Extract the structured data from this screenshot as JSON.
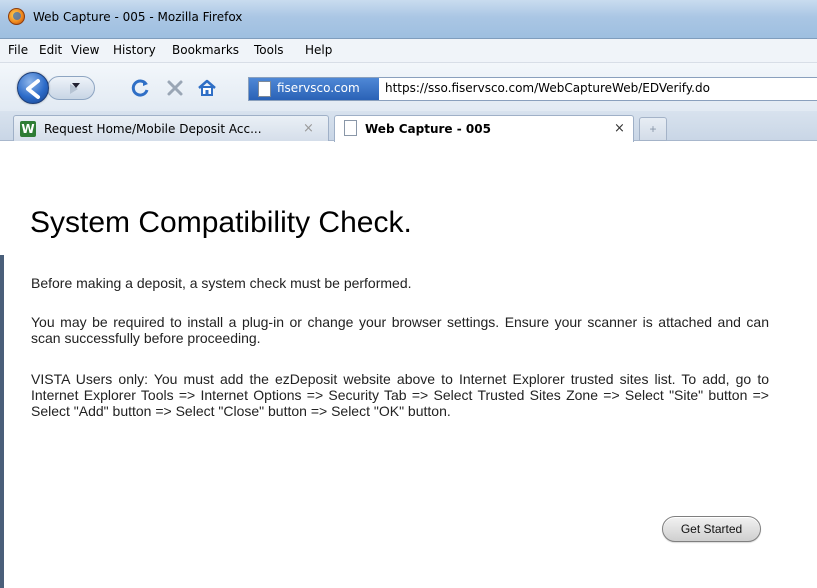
{
  "window": {
    "title": "Web Capture - 005 - Mozilla Firefox"
  },
  "menubar": {
    "items": [
      "File",
      "Edit",
      "View",
      "History",
      "Bookmarks",
      "Tools",
      "Help"
    ]
  },
  "navbar": {
    "site_identity": "fiservsco.com",
    "url": "https://sso.fiservsco.com/WebCaptureWeb/EDVerify.do"
  },
  "tabs": [
    {
      "label": "Request Home/Mobile Deposit Acc...",
      "close": "×",
      "icon": "W"
    },
    {
      "label": "Web Capture - 005",
      "close": "×"
    }
  ],
  "newtab_symbol": "+",
  "main": {
    "title": "System Compatibility Check.",
    "paragraphs": [
      "Before making a deposit, a system check must be performed.",
      "You may be required to install a plug-in or change your browser settings. Ensure your scanner is attached and can scan successfully before proceeding.",
      "VISTA Users only: You must add the ezDeposit website above to Internet Explorer trusted sites list. To add, go to Internet Explorer Tools => Internet Options => Security Tab => Select Trusted Sites Zone => Select \"Site\" button => Select \"Add\" button => Select \"Close\" button => Select \"OK\" button."
    ],
    "button_label": "Get Started"
  },
  "icons": {
    "firefox": "firefox-logo-icon",
    "back": "back-arrow-icon",
    "forward": "forward-arrow-icon",
    "reload": "reload-icon",
    "stop": "stop-icon",
    "home": "home-icon",
    "page": "page-icon"
  },
  "colors": {
    "accent": "#2a62b6",
    "titlebar": "#aac6e4",
    "content_bg": "#ffffff"
  }
}
